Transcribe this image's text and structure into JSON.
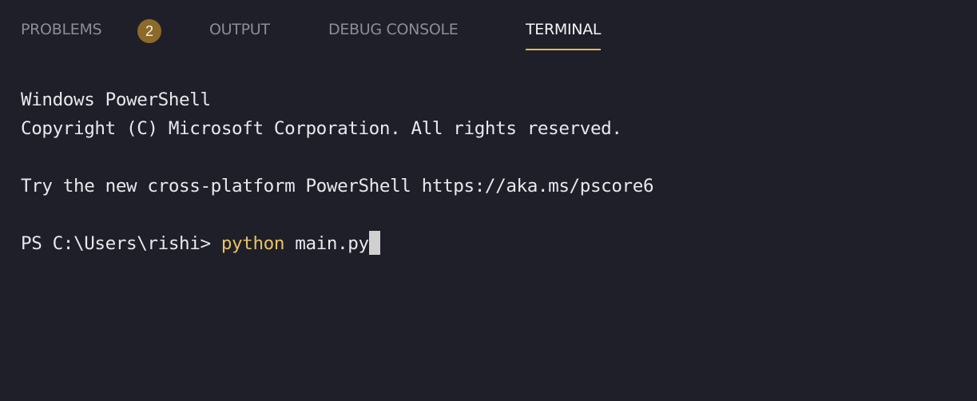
{
  "tabs": {
    "problems": "PROBLEMS",
    "problems_count": "2",
    "output": "OUTPUT",
    "debug_console": "DEBUG CONSOLE",
    "terminal": "TERMINAL",
    "active": "terminal"
  },
  "terminal": {
    "line1": "Windows PowerShell",
    "line2": "Copyright (C) Microsoft Corporation. All rights reserved.",
    "line3": "Try the new cross-platform PowerShell https://aka.ms/pscore6",
    "prompt": "PS C:\\Users\\rishi> ",
    "command": "python",
    "args": " main.py"
  },
  "colors": {
    "background": "#1e1f29",
    "active_tab_underline": "#e6b450",
    "badge": "#8d6a2a",
    "command": "#e8c163"
  }
}
